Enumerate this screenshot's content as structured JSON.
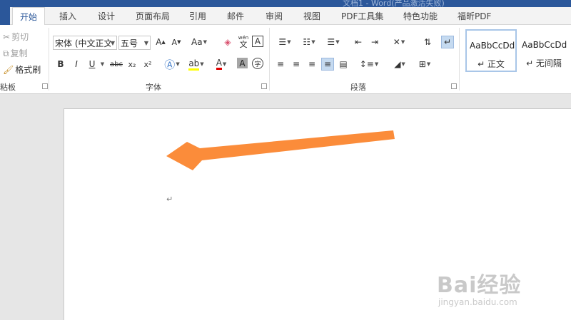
{
  "window": {
    "title_fragment": "文档1 - Word(产品激活失败)"
  },
  "tabs": [
    {
      "label": "开始",
      "active": true
    },
    {
      "label": "插入"
    },
    {
      "label": "设计"
    },
    {
      "label": "页面布局"
    },
    {
      "label": "引用"
    },
    {
      "label": "邮件"
    },
    {
      "label": "审阅"
    },
    {
      "label": "视图"
    },
    {
      "label": "PDF工具集"
    },
    {
      "label": "特色功能"
    },
    {
      "label": "福昕PDF"
    }
  ],
  "clipboard": {
    "cut": "剪切",
    "copy": "复制",
    "format_painter": "格式刷",
    "group_label": "粘板"
  },
  "font": {
    "font_name": "宋体 (中文正文",
    "font_size": "五号",
    "group_label": "字体",
    "bold": "B",
    "italic": "I",
    "underline": "U",
    "strikethrough": "abc",
    "subscript": "x₂",
    "superscript": "x²",
    "change_case": "Aa",
    "phonetic": "wén",
    "phonetic_char": "文",
    "border_char": "A",
    "enclose_char": "字"
  },
  "paragraph": {
    "group_label": "段落"
  },
  "styles": {
    "items": [
      {
        "sample": "AaBbCcDd",
        "name": "↵ 正文",
        "selected": true
      },
      {
        "sample": "AaBbCcDd",
        "name": "↵ 无间隔"
      }
    ]
  },
  "document": {
    "paragraph_mark": "↵"
  },
  "annotation": {
    "color": "#fb8c3a"
  },
  "watermark": {
    "main": "Bai经验",
    "sub": "jingyan.baidu.com"
  },
  "colors": {
    "accent": "#2b579a",
    "font_color": "#e00000"
  }
}
